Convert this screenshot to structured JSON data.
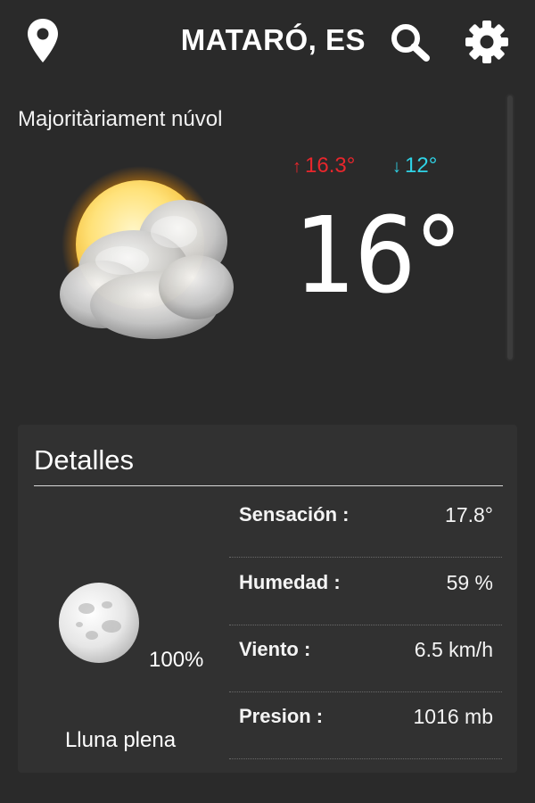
{
  "header": {
    "city": "MATARÓ, ES",
    "location_icon": "location-pin-icon",
    "search_icon": "search-icon",
    "settings_icon": "gear-icon"
  },
  "current": {
    "condition": "Majoritàriament núvol",
    "high": "16.3°",
    "low": "12°",
    "high_arrow": "↑",
    "low_arrow": "↓",
    "temperature": "16°",
    "icon": "mostly-cloudy-icon",
    "colors": {
      "high": "#e8262c",
      "low": "#2fd3e6"
    }
  },
  "details": {
    "title": "Detalles",
    "moon": {
      "icon": "full-moon-icon",
      "illumination": "100%",
      "phase": "Lluna plena"
    },
    "rows": [
      {
        "label": "Sensación :",
        "value": "17.8°"
      },
      {
        "label": "Humedad :",
        "value": "59 %"
      },
      {
        "label": "Viento :",
        "value": "6.5 km/h"
      },
      {
        "label": "Presion :",
        "value": "1016 mb"
      }
    ]
  }
}
